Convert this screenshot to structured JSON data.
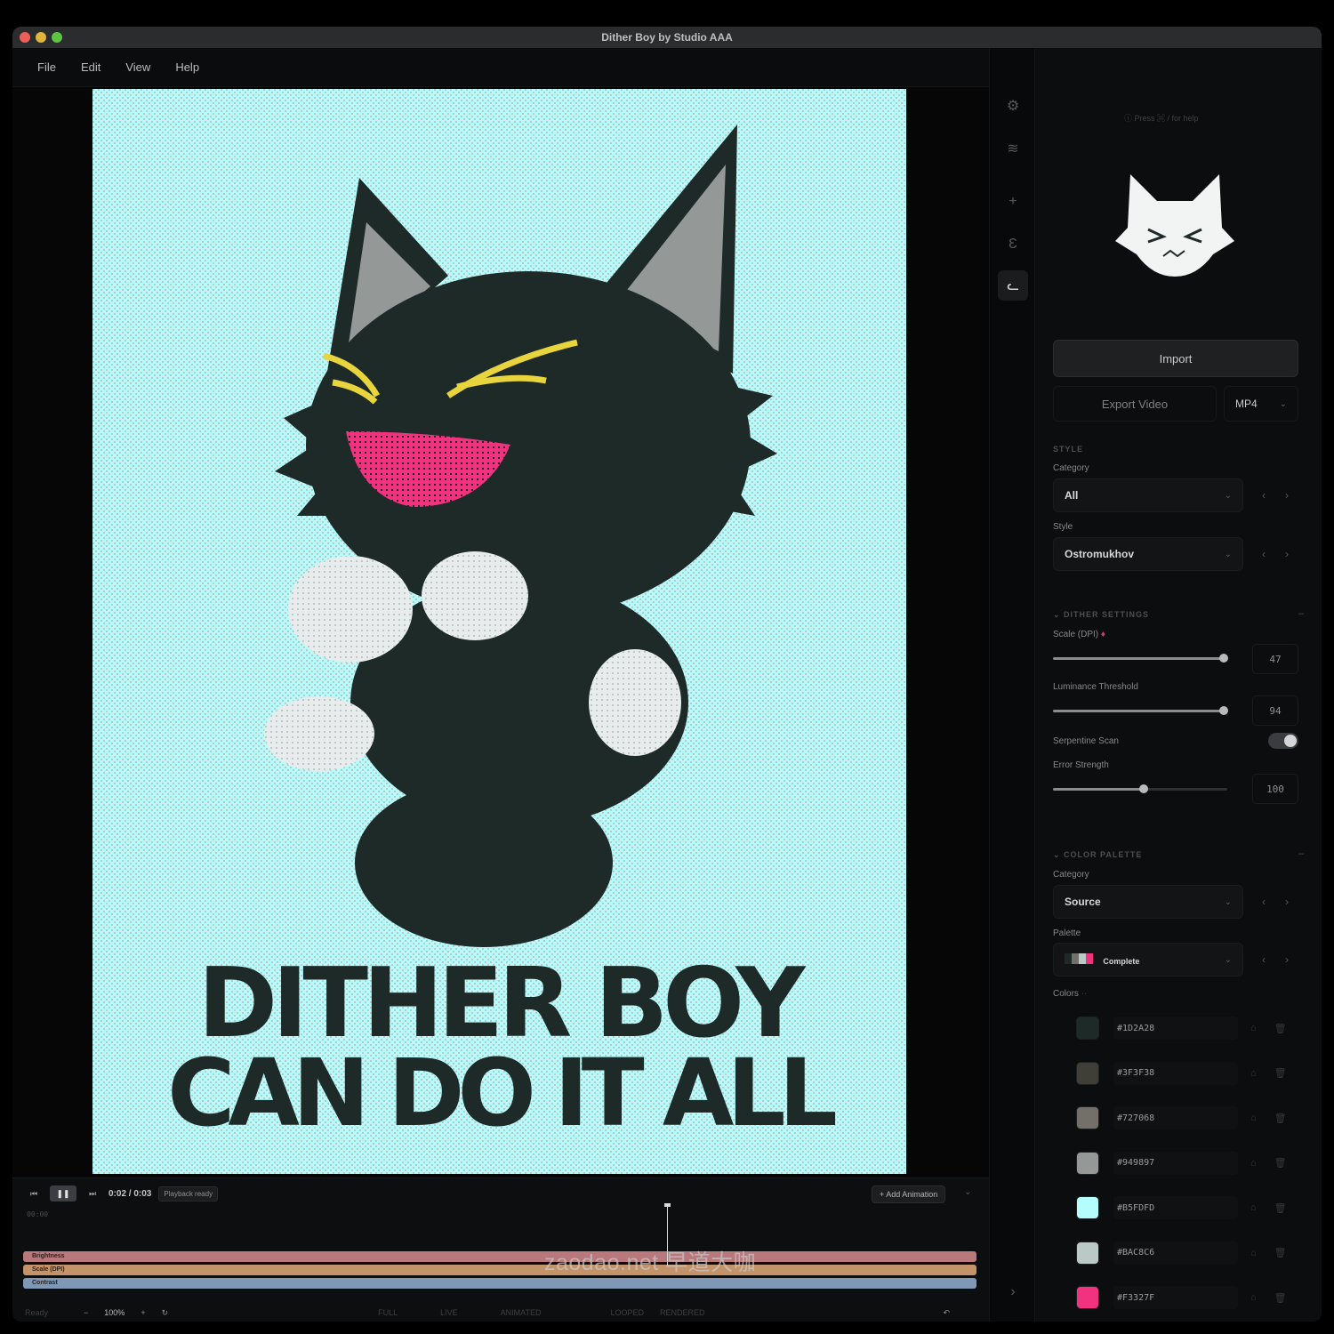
{
  "window": {
    "title": "Dither Boy by Studio AAA"
  },
  "menu": [
    "File",
    "Edit",
    "View",
    "Help"
  ],
  "tools": [
    {
      "name": "settings-gear-icon",
      "glyph": "⚙"
    },
    {
      "name": "layers-icon",
      "glyph": "≋"
    },
    {
      "name": "add-icon",
      "glyph": "+"
    },
    {
      "name": "effects-icon",
      "glyph": "Ɛ"
    },
    {
      "name": "cat-mascot-icon",
      "glyph": "ᓚ"
    }
  ],
  "artwork": {
    "line1": "DITHER BOY",
    "line2": "CAN DO IT ALL",
    "bg_color": "#B5FDFD",
    "ink_color": "#1D2A28"
  },
  "panel": {
    "help_hint": "ⓘ Press ⌘ / for help",
    "import_label": "Import",
    "export_label": "Export Video",
    "export_format": "MP4",
    "style_section": "STYLE",
    "category_label": "Category",
    "category_value": "All",
    "style_label": "Style",
    "style_value": "Ostromukhov",
    "dither_section": "DITHER SETTINGS",
    "scale_label": "Scale (DPI)",
    "scale_value": "47",
    "luminance_label": "Luminance Threshold",
    "luminance_value": "94",
    "serpentine_label": "Serpentine Scan",
    "error_label": "Error Strength",
    "error_value": "100",
    "palette_section": "COLOR PALETTE",
    "palette_category_label": "Category",
    "palette_category_value": "Source",
    "palette_label": "Palette",
    "palette_value": "Complete",
    "colors_label": "Colors",
    "colors": [
      "#1D2A28",
      "#3F3F38",
      "#727068",
      "#949897",
      "#B5FDFD",
      "#BAC8C6",
      "#F3327F"
    ],
    "sliders": {
      "scale": 0.98,
      "luminance": 0.98,
      "error": 0.52
    }
  },
  "timeline": {
    "time": "0:02 / 0:03",
    "status_badge": "Playback ready",
    "add_animation": "+ Add Animation",
    "ruler_start": "00:00",
    "tracks": [
      {
        "label": "Brightness",
        "color": "#b8787c"
      },
      {
        "label": "Scale (DPI)",
        "color": "#c4936a"
      },
      {
        "label": "Contrast",
        "color": "#7f98b5"
      }
    ],
    "playhead_fraction": 0.675
  },
  "status": {
    "ready": "Ready",
    "zoom_out": "−",
    "zoom": "100%",
    "zoom_in": "+",
    "reset": "↻",
    "modes": [
      "FULL",
      "LIVE",
      "ANIMATED",
      "LOOPED",
      "RENDERED"
    ]
  },
  "watermark": "zaodao.net 早道大咖"
}
